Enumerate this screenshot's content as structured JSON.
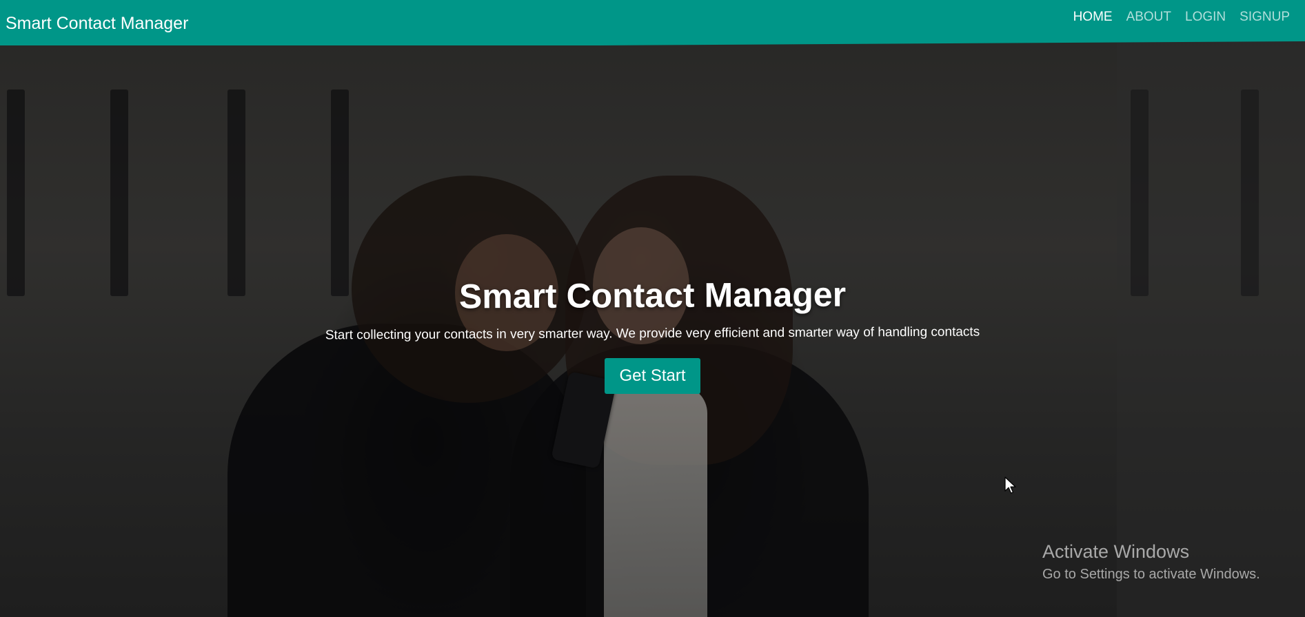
{
  "navbar": {
    "brand": "Smart Contact Manager",
    "links": [
      {
        "label": "HOME"
      },
      {
        "label": "ABOUT"
      },
      {
        "label": "LOGIN"
      },
      {
        "label": "SIGNUP"
      }
    ],
    "active_index": 0,
    "color": "#009688"
  },
  "hero": {
    "title": "Smart Contact Manager",
    "subtitle": "Start collecting your contacts in very smarter way. We provide very efficient and smarter way of handling contacts",
    "cta_label": "Get Start"
  },
  "watermark": {
    "title": "Activate Windows",
    "subtitle": "Go to Settings to activate Windows."
  },
  "cursor": {
    "icon": "mouse-pointer-icon"
  }
}
